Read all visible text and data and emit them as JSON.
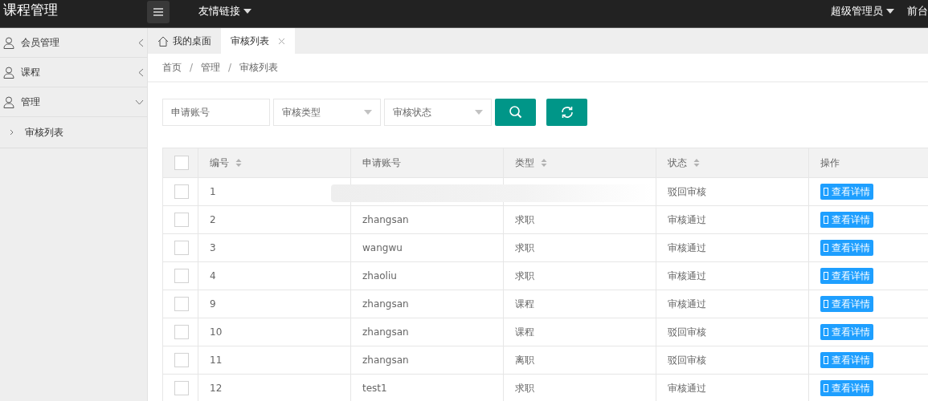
{
  "header": {
    "title": "课程管理",
    "nav": [
      {
        "label": "友情链接"
      }
    ],
    "user": "超级管理员",
    "right_link": "前台"
  },
  "sidebar": {
    "items": [
      {
        "label": "会员管理",
        "expanded": false
      },
      {
        "label": "课程",
        "expanded": false
      },
      {
        "label": "管理",
        "expanded": true,
        "children": [
          {
            "label": "审核列表"
          }
        ]
      }
    ]
  },
  "tabs": [
    {
      "label": "我的桌面",
      "selected": false,
      "kind": "home"
    },
    {
      "label": "审核列表",
      "selected": true,
      "kind": "closable"
    }
  ],
  "breadcrumb": [
    "首页",
    "管理",
    "审核列表"
  ],
  "breadcrumb_separator": "/",
  "filters": {
    "account": {
      "placeholder": "申请账号"
    },
    "type": {
      "placeholder": "审核类型"
    },
    "status": {
      "placeholder": "审核状态"
    }
  },
  "table": {
    "select_all_checked": false,
    "columns": [
      {
        "label": "编号",
        "sortable": true
      },
      {
        "label": "申请账号",
        "sortable": false
      },
      {
        "label": "类型",
        "sortable": true
      },
      {
        "label": "状态",
        "sortable": true
      },
      {
        "label": "操作",
        "sortable": false
      }
    ],
    "rows": [
      {
        "id": "1",
        "status": "驳回审核",
        "action": "查看详情",
        "redacted": true,
        "checked": false
      },
      {
        "id": "2",
        "account": "zhangsan",
        "type": "求职",
        "status": "审核通过",
        "action": "查看详情",
        "checked": false
      },
      {
        "id": "3",
        "account": "wangwu",
        "type": "求职",
        "status": "审核通过",
        "action": "查看详情",
        "checked": false
      },
      {
        "id": "4",
        "account": "zhaoliu",
        "type": "求职",
        "status": "审核通过",
        "action": "查看详情",
        "checked": false
      },
      {
        "id": "9",
        "account": "zhangsan",
        "type": "课程",
        "status": "审核通过",
        "action": "查看详情",
        "checked": false
      },
      {
        "id": "10",
        "account": "zhangsan",
        "type": "课程",
        "status": "驳回审核",
        "action": "查看详情",
        "checked": false
      },
      {
        "id": "11",
        "account": "zhangsan",
        "type": "离职",
        "status": "驳回审核",
        "action": "查看详情",
        "checked": false
      },
      {
        "id": "12",
        "account": "test1",
        "type": "求职",
        "status": "审核通过",
        "action": "查看详情",
        "checked": false
      }
    ]
  }
}
